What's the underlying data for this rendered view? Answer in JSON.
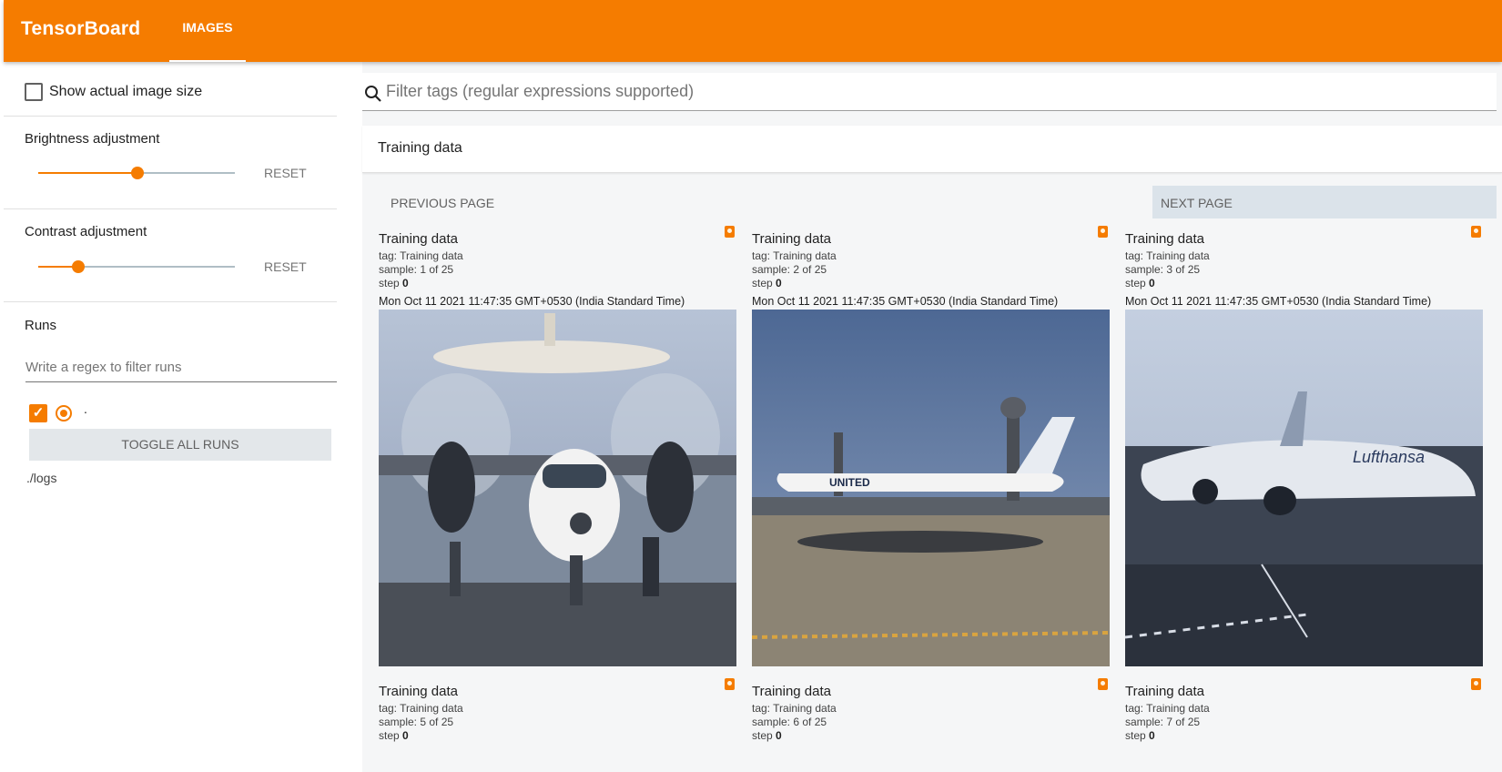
{
  "app": {
    "brand": "TensorBoard",
    "active_tab": "IMAGES"
  },
  "sidebar": {
    "show_actual_size_label": "Show actual image size",
    "show_actual_size_checked": false,
    "brightness": {
      "label": "Brightness adjustment",
      "reset": "RESET",
      "value": 0.5
    },
    "contrast": {
      "label": "Contrast adjustment",
      "reset": "RESET",
      "value": 0.2
    },
    "runs": {
      "title": "Runs",
      "filter_placeholder": "Write a regex to filter runs",
      "items": [
        {
          "name": ".",
          "checked": true,
          "selected": true
        }
      ],
      "toggle_label": "TOGGLE ALL RUNS",
      "logdir": "./logs"
    }
  },
  "main": {
    "filter_placeholder": "Filter tags (regular expressions supported)",
    "group_title": "Training data",
    "prev_label": "PREVIOUS PAGE",
    "next_label": "NEXT PAGE",
    "cards": [
      {
        "title": "Training data",
        "tag": "tag: Training data",
        "sample": "sample: 1 of 25",
        "step_label": "step",
        "step": "0",
        "time": "Mon Oct 11 2021 11:47:35 GMT+0530 (India Standard Time)",
        "image": "airplane-radar-dome"
      },
      {
        "title": "Training data",
        "tag": "tag: Training data",
        "sample": "sample: 2 of 25",
        "step_label": "step",
        "step": "0",
        "time": "Mon Oct 11 2021 11:47:35 GMT+0530 (India Standard Time)",
        "image": "united-airliner"
      },
      {
        "title": "Training data",
        "tag": "tag: Training data",
        "sample": "sample: 3 of 25",
        "step_label": "step",
        "step": "0",
        "time": "Mon Oct 11 2021 11:47:35 GMT+0530 (India Standard Time)",
        "image": "lufthansa-a380"
      },
      {
        "title": "Training data",
        "tag": "tag: Training data",
        "sample": "sample: 5 of 25",
        "step_label": "step",
        "step": "0",
        "time": "",
        "image": ""
      },
      {
        "title": "Training data",
        "tag": "tag: Training data",
        "sample": "sample: 6 of 25",
        "step_label": "step",
        "step": "0",
        "time": "",
        "image": ""
      },
      {
        "title": "Training data",
        "tag": "tag: Training data",
        "sample": "sample: 7 of 25",
        "step_label": "step",
        "step": "0",
        "time": "",
        "image": ""
      }
    ]
  },
  "colors": {
    "accent": "#f57c00",
    "toggle_bg": "#e3e7ea"
  }
}
